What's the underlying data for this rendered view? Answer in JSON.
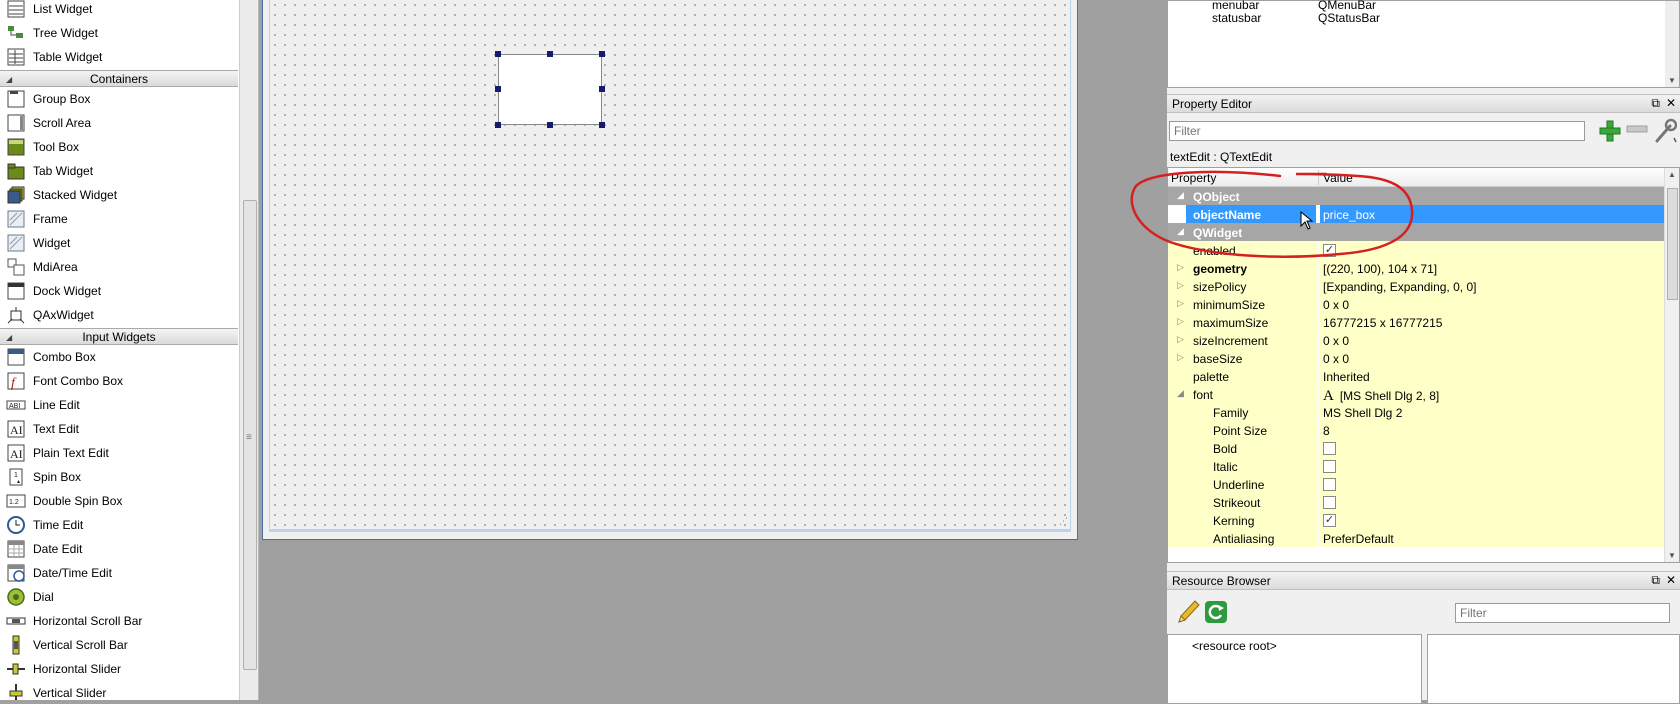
{
  "widget_box": {
    "items_top": [
      {
        "label": "List Widget",
        "icon": "list-widget-icon"
      },
      {
        "label": "Tree Widget",
        "icon": "tree-widget-icon"
      },
      {
        "label": "Table Widget",
        "icon": "table-widget-icon"
      }
    ],
    "categories": {
      "containers": "Containers",
      "input_widgets": "Input Widgets"
    },
    "containers": [
      {
        "label": "Group Box",
        "icon": "group-box-icon"
      },
      {
        "label": "Scroll Area",
        "icon": "scroll-area-icon"
      },
      {
        "label": "Tool Box",
        "icon": "tool-box-icon"
      },
      {
        "label": "Tab Widget",
        "icon": "tab-widget-icon"
      },
      {
        "label": "Stacked Widget",
        "icon": "stacked-widget-icon"
      },
      {
        "label": "Frame",
        "icon": "frame-icon"
      },
      {
        "label": "Widget",
        "icon": "widget-icon"
      },
      {
        "label": "MdiArea",
        "icon": "mdi-area-icon"
      },
      {
        "label": "Dock Widget",
        "icon": "dock-widget-icon"
      },
      {
        "label": "QAxWidget",
        "icon": "qax-widget-icon"
      }
    ],
    "input_widgets": [
      {
        "label": "Combo Box",
        "icon": "combo-box-icon"
      },
      {
        "label": "Font Combo Box",
        "icon": "font-combo-box-icon"
      },
      {
        "label": "Line Edit",
        "icon": "line-edit-icon"
      },
      {
        "label": "Text Edit",
        "icon": "text-edit-icon"
      },
      {
        "label": "Plain Text Edit",
        "icon": "plain-text-edit-icon"
      },
      {
        "label": "Spin Box",
        "icon": "spin-box-icon"
      },
      {
        "label": "Double Spin Box",
        "icon": "double-spin-box-icon"
      },
      {
        "label": "Time Edit",
        "icon": "time-edit-icon"
      },
      {
        "label": "Date Edit",
        "icon": "date-edit-icon"
      },
      {
        "label": "Date/Time Edit",
        "icon": "date-time-edit-icon"
      },
      {
        "label": "Dial",
        "icon": "dial-icon"
      },
      {
        "label": "Horizontal Scroll Bar",
        "icon": "horizontal-scroll-bar-icon"
      },
      {
        "label": "Vertical Scroll Bar",
        "icon": "vertical-scroll-bar-icon"
      },
      {
        "label": "Horizontal Slider",
        "icon": "horizontal-slider-icon"
      },
      {
        "label": "Vertical Slider",
        "icon": "vertical-slider-icon"
      }
    ]
  },
  "object_inspector": {
    "rows": [
      {
        "object": "menubar",
        "class": "QMenuBar"
      },
      {
        "object": "statusbar",
        "class": "QStatusBar"
      }
    ]
  },
  "property_editor": {
    "title": "Property Editor",
    "filter_placeholder": "Filter",
    "object_label": "textEdit : QTextEdit",
    "header": {
      "property": "Property",
      "value": "Value"
    },
    "rows": [
      {
        "kind": "group",
        "name": "QObject"
      },
      {
        "kind": "selected",
        "name": "objectName",
        "value": "price_box"
      },
      {
        "kind": "group",
        "name": "QWidget"
      },
      {
        "kind": "check",
        "name": "enabled",
        "checked": true
      },
      {
        "kind": "text",
        "name": "geometry",
        "value": "[(220, 100), 104 x 71]",
        "bold": true,
        "expandable": true
      },
      {
        "kind": "text",
        "name": "sizePolicy",
        "value": "[Expanding, Expanding, 0, 0]",
        "expandable": true
      },
      {
        "kind": "text",
        "name": "minimumSize",
        "value": "0 x 0",
        "expandable": true
      },
      {
        "kind": "text",
        "name": "maximumSize",
        "value": "16777215 x 16777215",
        "expandable": true
      },
      {
        "kind": "text",
        "name": "sizeIncrement",
        "value": "0 x 0",
        "expandable": true
      },
      {
        "kind": "text",
        "name": "baseSize",
        "value": "0 x 0",
        "expandable": true
      },
      {
        "kind": "text",
        "name": "palette",
        "value": "Inherited"
      },
      {
        "kind": "font",
        "name": "font",
        "value": "[MS Shell Dlg 2, 8]",
        "expanded": true
      },
      {
        "kind": "text",
        "name": "Family",
        "value": "MS Shell Dlg 2",
        "sub": true
      },
      {
        "kind": "text",
        "name": "Point Size",
        "value": "8",
        "sub": true
      },
      {
        "kind": "check",
        "name": "Bold",
        "checked": false,
        "sub": true
      },
      {
        "kind": "check",
        "name": "Italic",
        "checked": false,
        "sub": true
      },
      {
        "kind": "check",
        "name": "Underline",
        "checked": false,
        "sub": true
      },
      {
        "kind": "check",
        "name": "Strikeout",
        "checked": false,
        "sub": true
      },
      {
        "kind": "check",
        "name": "Kerning",
        "checked": true,
        "sub": true
      },
      {
        "kind": "text",
        "name": "Antialiasing",
        "value": "PreferDefault",
        "sub": true
      }
    ]
  },
  "resource_browser": {
    "title": "Resource Browser",
    "filter_placeholder": "Filter",
    "root": "<resource root>"
  },
  "glyphs": {
    "restore": "⧉",
    "close": "✕",
    "check": "✓",
    "font_a": "A"
  },
  "colors": {
    "selection": "#3399ff",
    "property_row": "#ffffc8",
    "group_row": "#a6a6a6",
    "annotation": "#d42020"
  }
}
